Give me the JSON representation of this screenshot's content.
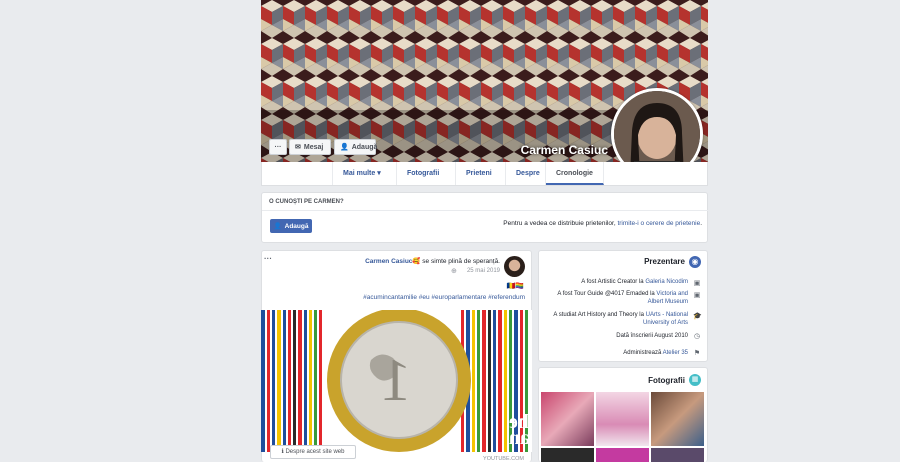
{
  "profile": {
    "name": "Carmen Casiuc",
    "add_button": "Adaugă",
    "message_button": "Mesaj",
    "more_button": "···"
  },
  "tabs": [
    {
      "label": "Cronologie"
    },
    {
      "label": "Despre"
    },
    {
      "label": "Prieteni"
    },
    {
      "label": "Fotografii"
    },
    {
      "label": "Mai multe ▾"
    }
  ],
  "know_card": {
    "header": "O CUNOȘTI PE CARMEN?",
    "text_prefix": "Pentru a vedea ce distribuie prietenilor, ",
    "text_link": "trimite-i o cerere de prietenie",
    "text_suffix": ".",
    "add_button": "Adaugă"
  },
  "intro": {
    "title": "Prezentare",
    "items": [
      {
        "icon": "briefcase-icon",
        "text": "A fost Artistic Creator la ",
        "link": "Galeria Nicodim"
      },
      {
        "icon": "briefcase-icon",
        "text": "A fost Tour Guide @4017 Emaded la ",
        "link": "Victoria and Albert Museum"
      },
      {
        "icon": "graduation-cap-icon",
        "text": "A studiat Art History and Theory la ",
        "link": "UArts - National University of Arts"
      },
      {
        "icon": "clock-icon",
        "text": "Dată înscrierii August 2010",
        "link": ""
      },
      {
        "icon": "flag-icon",
        "text": "Administrează ",
        "link": "Atelier 35"
      }
    ]
  },
  "photos_card": {
    "title": "Fotografii"
  },
  "post": {
    "author": "Carmen Casiuc",
    "feeling": " se simte plină de speranță.",
    "date": "25 mai 2019",
    "flags": "🇷🇴🏳️‍🌈",
    "hashtags": "#acumincantamilie #eu #europarlamentare #referendum",
    "link_source": "YOUTUBE.COM",
    "about_site": "Despre acest site web",
    "options": "···"
  },
  "colors": {
    "accent": "#4267b2",
    "link": "#365899",
    "background": "#e9ebee"
  }
}
